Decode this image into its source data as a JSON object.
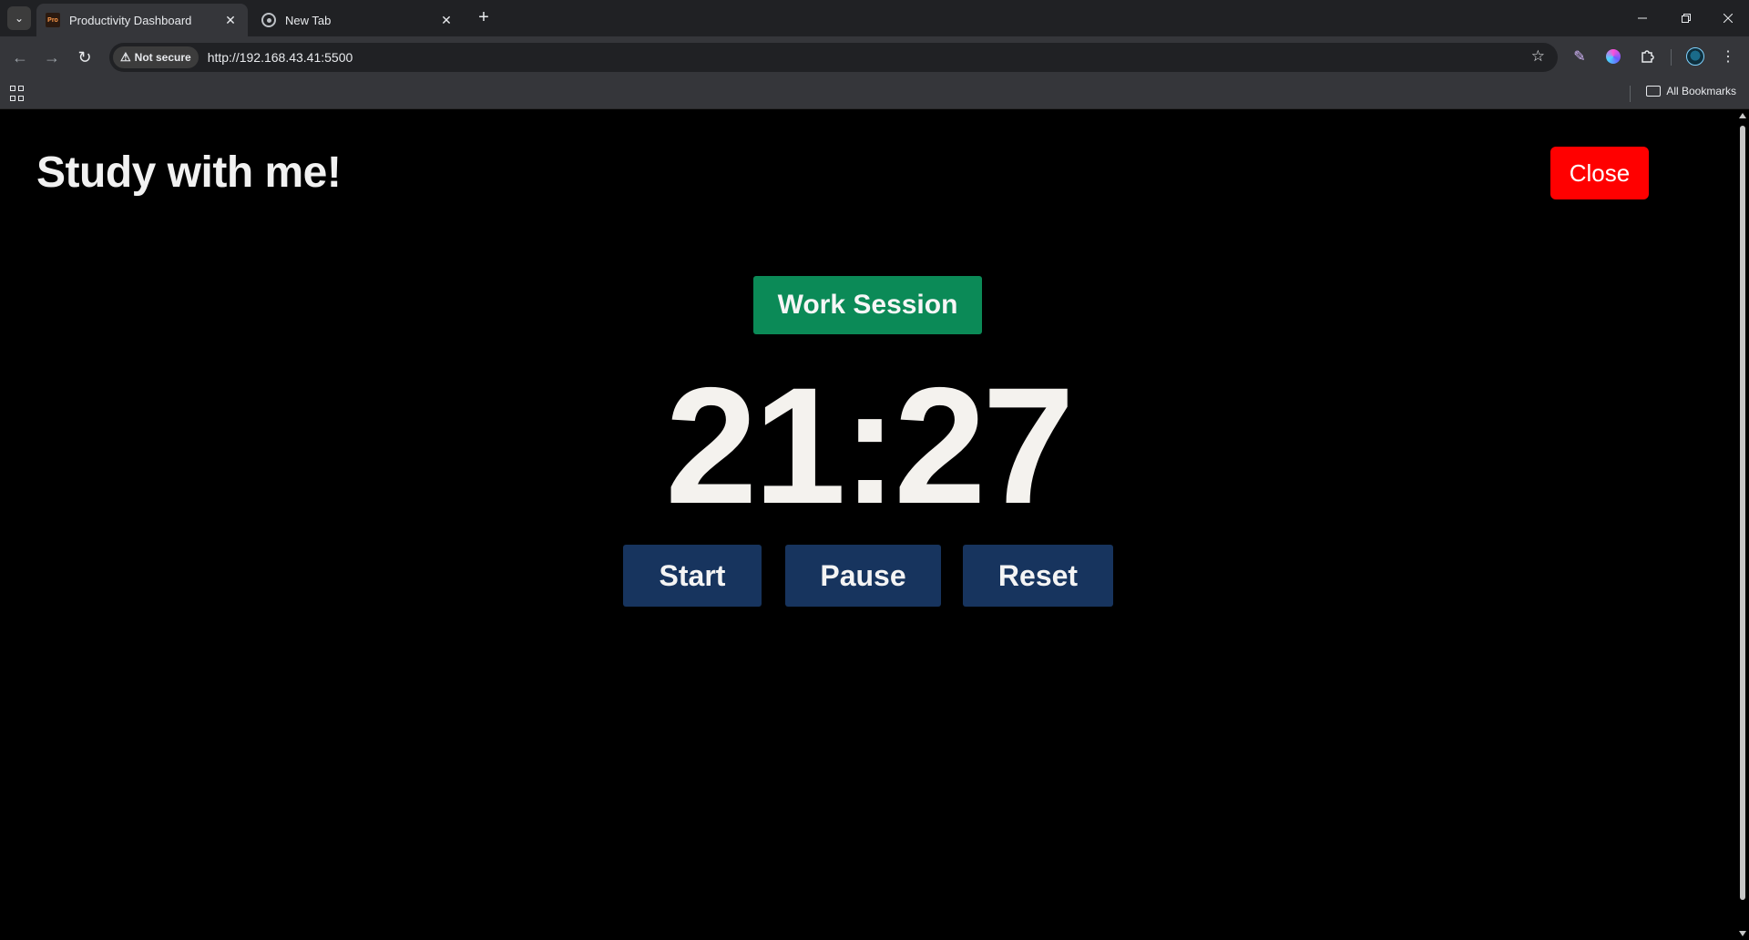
{
  "browser": {
    "tabs": [
      {
        "favicon": "Pro",
        "title": "Productivity Dashboard",
        "close": "✕"
      },
      {
        "title": "New Tab",
        "close": "✕"
      }
    ],
    "new_tab": "+",
    "address": {
      "security_label": "Not secure",
      "url": "http://192.168.43.41:5500"
    },
    "bookmarks": {
      "all_bookmarks_label": "All Bookmarks"
    }
  },
  "page": {
    "heading": "Study with me!",
    "close_label": "Close",
    "session_label": "Work Session",
    "timer": "21:27",
    "controls": {
      "start": "Start",
      "pause": "Pause",
      "reset": "Reset"
    }
  },
  "colors": {
    "close_button": "#ff0000",
    "session_badge": "#0b8a57",
    "control_button": "#17345e",
    "background": "#000000"
  }
}
